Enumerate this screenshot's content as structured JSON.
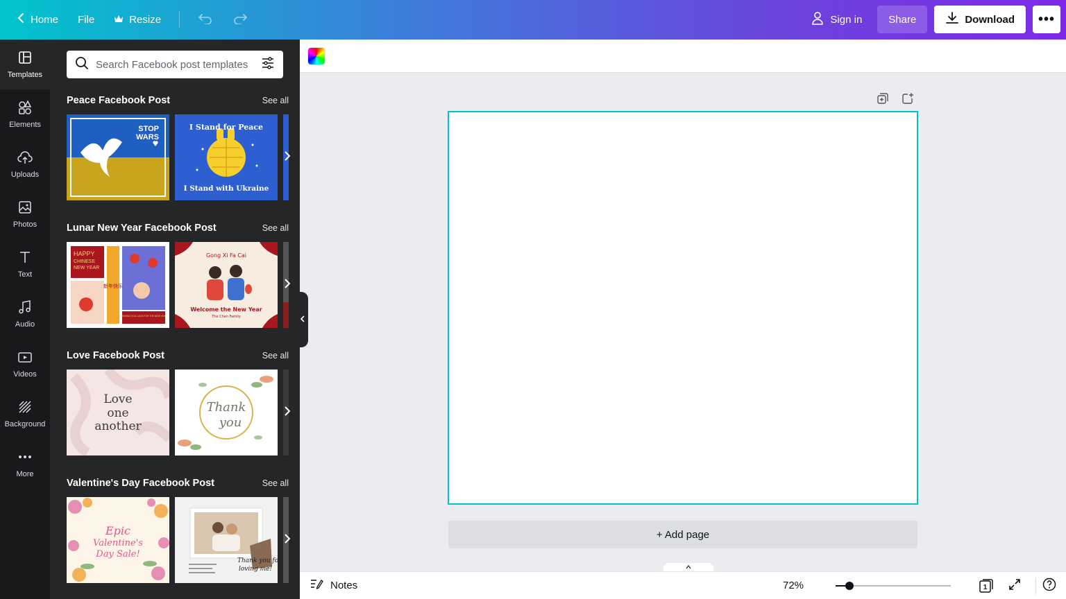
{
  "topbar": {
    "home": "Home",
    "file": "File",
    "resize": "Resize",
    "sign_in": "Sign in",
    "share": "Share",
    "download": "Download",
    "more": "•••"
  },
  "rail": {
    "items": [
      {
        "label": "Templates",
        "icon": "templates-icon",
        "active": true
      },
      {
        "label": "Elements",
        "icon": "elements-icon"
      },
      {
        "label": "Uploads",
        "icon": "uploads-icon"
      },
      {
        "label": "Photos",
        "icon": "photos-icon"
      },
      {
        "label": "Text",
        "icon": "text-icon"
      },
      {
        "label": "Audio",
        "icon": "audio-icon"
      },
      {
        "label": "Videos",
        "icon": "videos-icon"
      },
      {
        "label": "Background",
        "icon": "background-icon"
      },
      {
        "label": "More",
        "icon": "more-icon"
      }
    ]
  },
  "panel": {
    "search_placeholder": "Search Facebook post templates",
    "see_all": "See all",
    "sections": [
      {
        "title": "Peace Facebook Post",
        "thumb1": {
          "line1": "STOP",
          "line2": "WARS"
        },
        "thumb2": {
          "top": "I Stand for Peace",
          "bottom": "I Stand with Ukraine"
        }
      },
      {
        "title": "Lunar New Year Facebook Post",
        "thumb1": {
          "line1": "HAPPY",
          "line2": "CHINESE",
          "line3": "NEW YEAR",
          "chars": "新年快乐",
          "footer": "WISHING YOU LUCK FOR THE NEW YEAR"
        },
        "thumb2": {
          "top": "Gong Xi Fa Cai",
          "bottom": "Welcome the New Year",
          "sub": "The Chen Family"
        }
      },
      {
        "title": "Love Facebook Post",
        "thumb1": {
          "line1": "Love",
          "line2": "one",
          "line3": "another"
        },
        "thumb2": {
          "line1": "Thank",
          "line2": "you"
        }
      },
      {
        "title": "Valentine's Day Facebook Post",
        "thumb1": {
          "line1": "Epic",
          "line2": "Valentine's",
          "line3": "Day Sale!"
        },
        "thumb2": {
          "line1": "Thank you for",
          "line2": "loving me!"
        }
      }
    ]
  },
  "editor": {
    "add_page": "+ Add page",
    "notes": "Notes",
    "zoom": "72%",
    "zoom_fraction": 0.12,
    "page_count": "1"
  },
  "colors": {
    "accent": "#00c4cc",
    "brand_purple": "#7d2ae8",
    "rail_bg": "#18191b",
    "panel_bg": "#252627"
  }
}
